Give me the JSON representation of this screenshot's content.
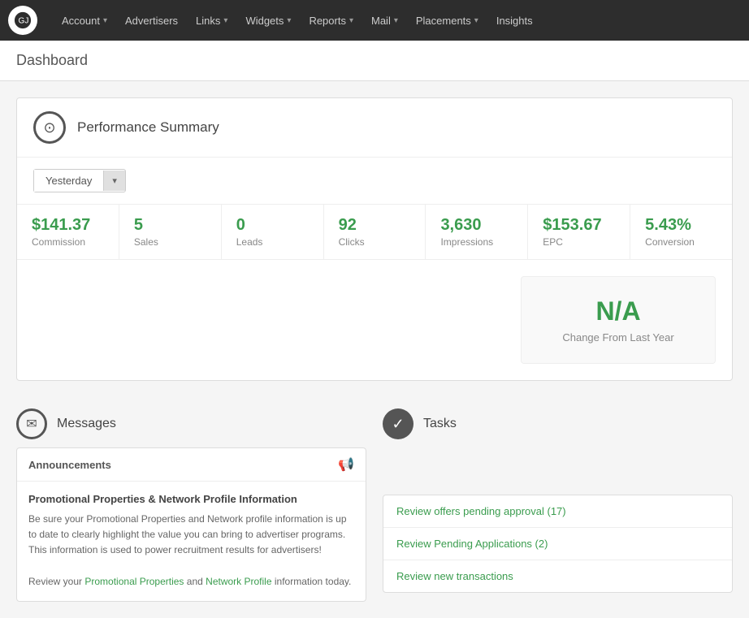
{
  "app": {
    "logo_text": "GJ"
  },
  "nav": {
    "items": [
      {
        "label": "Account",
        "has_arrow": true
      },
      {
        "label": "Advertisers",
        "has_arrow": false
      },
      {
        "label": "Links",
        "has_arrow": true
      },
      {
        "label": "Widgets",
        "has_arrow": true
      },
      {
        "label": "Reports",
        "has_arrow": true
      },
      {
        "label": "Mail",
        "has_arrow": true
      },
      {
        "label": "Placements",
        "has_arrow": true
      },
      {
        "label": "Insights",
        "has_arrow": false
      }
    ]
  },
  "breadcrumb": "Dashboard",
  "performance": {
    "title": "Performance Summary",
    "date_label": "Yesterday",
    "stats": [
      {
        "value": "$141.37",
        "label": "Commission"
      },
      {
        "value": "5",
        "label": "Sales"
      },
      {
        "value": "0",
        "label": "Leads"
      },
      {
        "value": "92",
        "label": "Clicks"
      },
      {
        "value": "3,630",
        "label": "Impressions"
      },
      {
        "value": "$153.67",
        "label": "EPC"
      },
      {
        "value": "5.43%",
        "label": "Conversion"
      }
    ],
    "nia": {
      "value": "N/A",
      "label": "Change From Last Year"
    }
  },
  "messages": {
    "section_title": "Messages",
    "announcements_title": "Announcements",
    "post_title": "Promotional Properties & Network Profile Information",
    "post_body": "Be sure your Promotional Properties and Network profile information is up to date to clearly highlight the value you can bring to advertiser programs. This information is used to power recruitment results for advertisers!",
    "post_cta1": "Promotional Properties",
    "post_cta2": "Network Profile",
    "post_footer": "information today.",
    "post_cta_prefix": "Review your",
    "post_cta_middle": "and"
  },
  "tasks": {
    "section_title": "Tasks",
    "items": [
      "Review offers pending approval (17)",
      "Review Pending Applications (2)",
      "Review new transactions"
    ]
  }
}
